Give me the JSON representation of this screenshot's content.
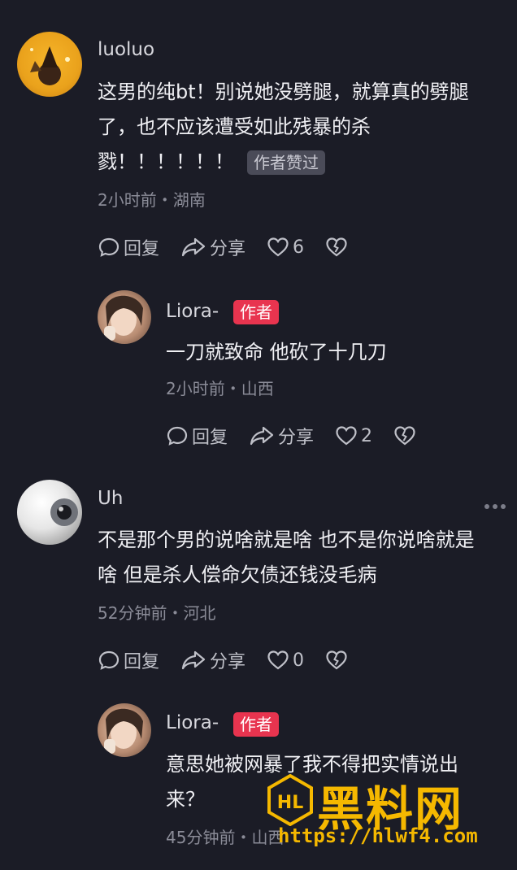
{
  "comments": [
    {
      "username": "luoluo",
      "text_lines": [
        "这男的纯bt！别说她没劈腿，就算真的劈腿",
        "了，也不应该遭受如此残暴的杀",
        "戮！！！！！！"
      ],
      "badge": "作者赞过",
      "meta": "2小时前・湖南",
      "reply_label": "回复",
      "share_label": "分享",
      "likes": "6"
    },
    {
      "username": "Liora-",
      "author_badge": "作者",
      "text": "一刀就致命 他砍了十几刀",
      "meta": "2小时前・山西",
      "reply_label": "回复",
      "share_label": "分享",
      "likes": "2"
    },
    {
      "username": "Uh",
      "text_lines": [
        "不是那个男的说啥就是啥 也不是你说啥就是",
        "啥 但是杀人偿命欠债还钱没毛病"
      ],
      "meta": "52分钟前・河北",
      "reply_label": "回复",
      "share_label": "分享",
      "likes": "0"
    },
    {
      "username": "Liora-",
      "author_badge": "作者",
      "text_lines": [
        "意思她被网暴了我不得把实情说出",
        "来？"
      ],
      "meta": "45分钟前・山西"
    }
  ],
  "watermark": {
    "title": "黑料网",
    "url": "https://hlwf4.com",
    "logo": "HL"
  },
  "colors": {
    "background": "#1b1c26",
    "author_badge": "#e8344f",
    "watermark": "#f5b800"
  },
  "icons": [
    "comment-icon",
    "share-icon",
    "heart-icon",
    "broken-heart-icon",
    "more-dots-icon"
  ]
}
